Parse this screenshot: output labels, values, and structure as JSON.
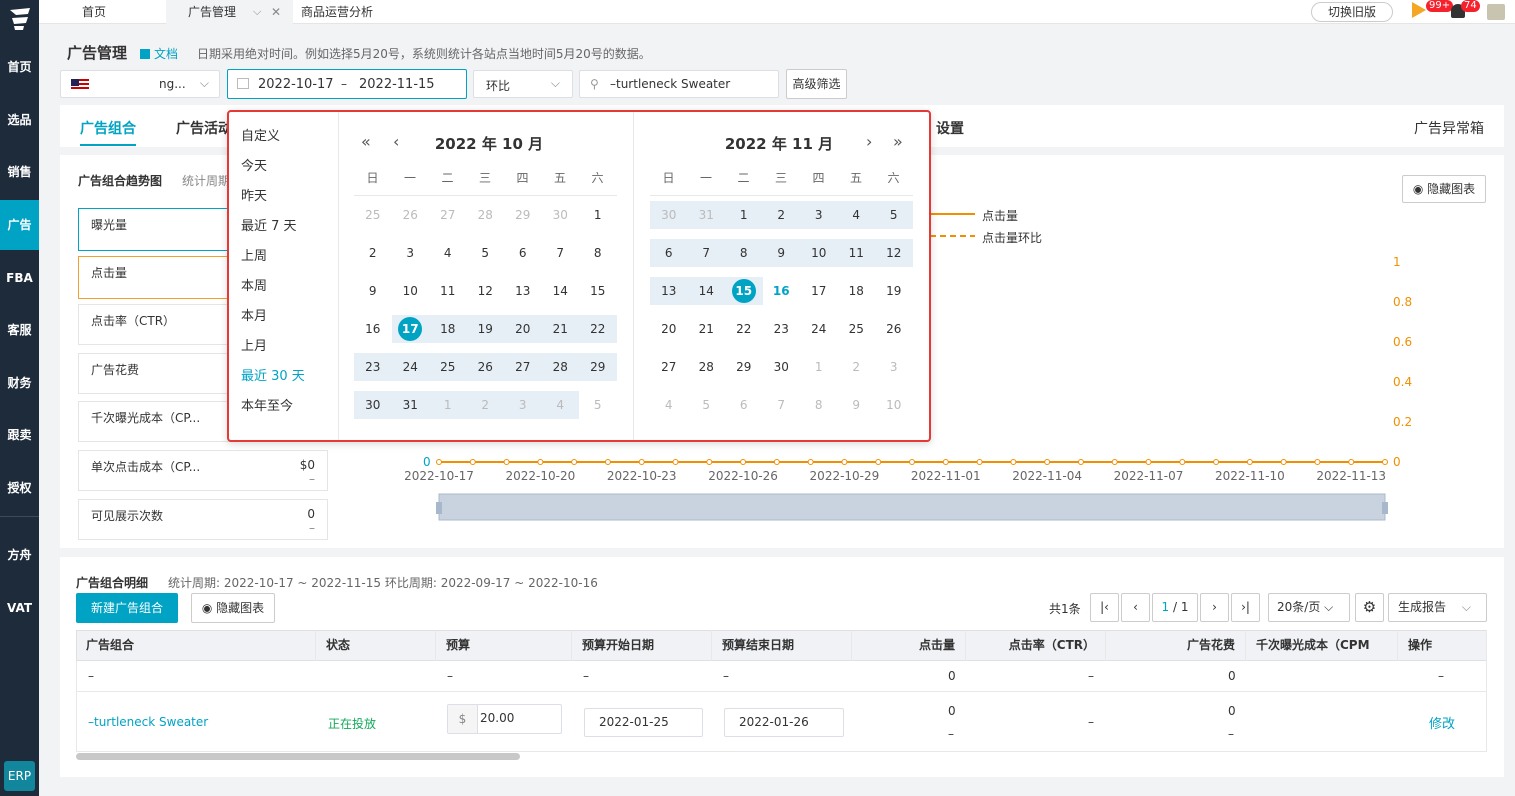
{
  "sidebar": {
    "items": [
      "首页",
      "选品",
      "销售",
      "广告",
      "FBA",
      "客服",
      "财务",
      "跟卖",
      "授权",
      "方舟",
      "VAT"
    ],
    "erp": "ERP"
  },
  "topbar": {
    "tabs": [
      "首页",
      "广告管理",
      "商品运营分析"
    ],
    "old_version": "切换旧版",
    "badge1": "99+",
    "badge2": "74"
  },
  "header": {
    "title": "广告管理",
    "doc": "文档",
    "hint": "日期采用绝对时间。例如选择5月20号，系统则统计各站点当地时间5月20号的数据。"
  },
  "filters": {
    "shop": "ng...",
    "date_start": "2022-10-17",
    "date_sep": "–",
    "date_end": "2022-11-15",
    "compare": "环比",
    "search": "–turtleneck Sweater",
    "advanced": "高级筛选"
  },
  "tabs": {
    "t1": "广告组合",
    "t2": "广告活动",
    "t3": "设置",
    "right": "广告异常箱"
  },
  "trend": {
    "title": "广告组合趋势图",
    "period": "统计周期",
    "hide_chart": "隐藏图表",
    "legend1": "点击量",
    "legend2": "点击量环比",
    "metrics": [
      {
        "name": "曝光量",
        "value": "",
        "sub": ""
      },
      {
        "name": "点击量",
        "value": "",
        "sub": ""
      },
      {
        "name": "点击率（CTR）",
        "value": "",
        "sub": ""
      },
      {
        "name": "广告花费",
        "value": "",
        "sub": ""
      },
      {
        "name": "千次曝光成本（CP...",
        "value": "",
        "sub": ""
      },
      {
        "name": "单次点击成本（CP...",
        "value": "$0",
        "sub": "–"
      },
      {
        "name": "可见展示次数",
        "value": "0",
        "sub": "–"
      }
    ]
  },
  "chart_data": {
    "type": "line",
    "x": [
      "2022-10-17",
      "2022-10-20",
      "2022-10-23",
      "2022-10-26",
      "2022-10-29",
      "2022-11-01",
      "2022-11-04",
      "2022-11-07",
      "2022-11-10",
      "2022-11-13"
    ],
    "series": [
      {
        "name": "点击量",
        "values": [
          0,
          0,
          0,
          0,
          0,
          0,
          0,
          0,
          0,
          0
        ]
      }
    ],
    "y_right": [
      "1",
      "0.8",
      "0.6",
      "0.4",
      "0.2",
      "0"
    ],
    "y_left_zero": "0",
    "ylim": [
      0,
      1
    ],
    "color": "#f08f00"
  },
  "detail": {
    "title": "广告组合明细",
    "period": "统计周期: 2022-10-17 ~ 2022-11-15 环比周期: 2022-09-17 ~ 2022-10-16",
    "new_btn": "新建广告组合",
    "hide_chart": "隐藏图表",
    "total": "共1条",
    "page": "1",
    "pages": "/ 1",
    "per_page": "20条/页",
    "report": "生成报告",
    "columns": [
      "广告组合",
      "状态",
      "预算",
      "预算开始日期",
      "预算结束日期",
      "点击量",
      "点击率（CTR）",
      "广告花费",
      "千次曝光成本（CPM",
      "操作"
    ],
    "summary": {
      "c0": "–",
      "c1": "",
      "c2": "–",
      "c3": "–",
      "c4": "–",
      "c5": "0",
      "c6": "–",
      "c7": "0",
      "c9": "–"
    },
    "row": {
      "name": "–turtleneck Sweater",
      "status": "正在投放",
      "currency": "$",
      "budget": "20.00",
      "start": "2022-01-25",
      "end": "2022-01-26",
      "clicks": "0",
      "clicks_sub": "–",
      "ctr": "–",
      "spend": "0",
      "spend_sub": "–",
      "action": "修改"
    }
  },
  "datepicker": {
    "presets": [
      "自定义",
      "今天",
      "昨天",
      "最近 7 天",
      "上周",
      "本周",
      "本月",
      "上月",
      "最近 30 天",
      "本年至今"
    ],
    "active_preset": 8,
    "weekdays": [
      "日",
      "一",
      "二",
      "三",
      "四",
      "五",
      "六"
    ],
    "left": {
      "title": "2022 年 10 月",
      "days": [
        "25",
        "26",
        "27",
        "28",
        "29",
        "30",
        "1",
        "2",
        "3",
        "4",
        "5",
        "6",
        "7",
        "8",
        "9",
        "10",
        "11",
        "12",
        "13",
        "14",
        "15",
        "16",
        "17",
        "18",
        "19",
        "20",
        "21",
        "22",
        "23",
        "24",
        "25",
        "26",
        "27",
        "28",
        "29",
        "30",
        "31",
        "1",
        "2",
        "3",
        "4",
        "5"
      ]
    },
    "right": {
      "title": "2022 年 11 月",
      "days": [
        "30",
        "31",
        "1",
        "2",
        "3",
        "4",
        "5",
        "6",
        "7",
        "8",
        "9",
        "10",
        "11",
        "12",
        "13",
        "14",
        "15",
        "16",
        "17",
        "18",
        "19",
        "20",
        "21",
        "22",
        "23",
        "24",
        "25",
        "26",
        "27",
        "28",
        "29",
        "30",
        "1",
        "2",
        "3",
        "4",
        "5",
        "6",
        "7",
        "8",
        "9",
        "10"
      ]
    }
  }
}
